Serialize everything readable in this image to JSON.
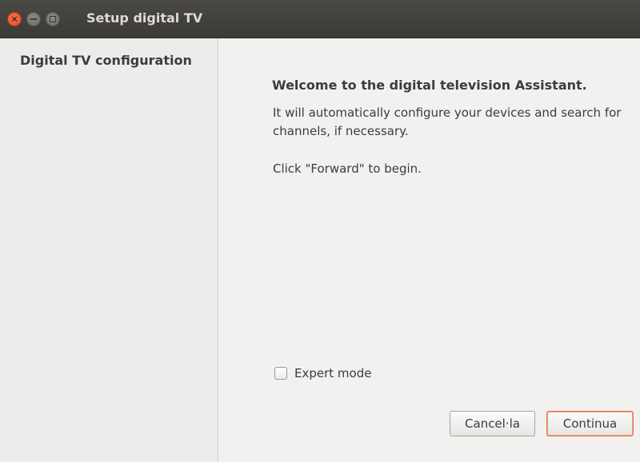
{
  "window": {
    "title": "Setup digital TV",
    "controls": {
      "close_icon": "close-icon",
      "minimize_icon": "minimize-icon",
      "maximize_icon": "maximize-icon"
    }
  },
  "sidebar": {
    "items": [
      {
        "label": "Digital TV configuration",
        "active": true
      }
    ]
  },
  "main": {
    "heading": "Welcome to the digital television Assistant.",
    "description": "It will automatically configure your devices and search for channels, if necessary.",
    "hint": "Click \"Forward\" to begin.",
    "expert_mode": {
      "label": "Expert mode",
      "checked": false
    }
  },
  "buttons": {
    "cancel": "Cancel·la",
    "forward": "Continua"
  },
  "colors": {
    "titlebar": "#3b3a37",
    "close_button": "#df4a1d",
    "focus_border": "#e2784b",
    "sidebar_bg": "#edeceb",
    "window_bg": "#f2f1f0"
  }
}
